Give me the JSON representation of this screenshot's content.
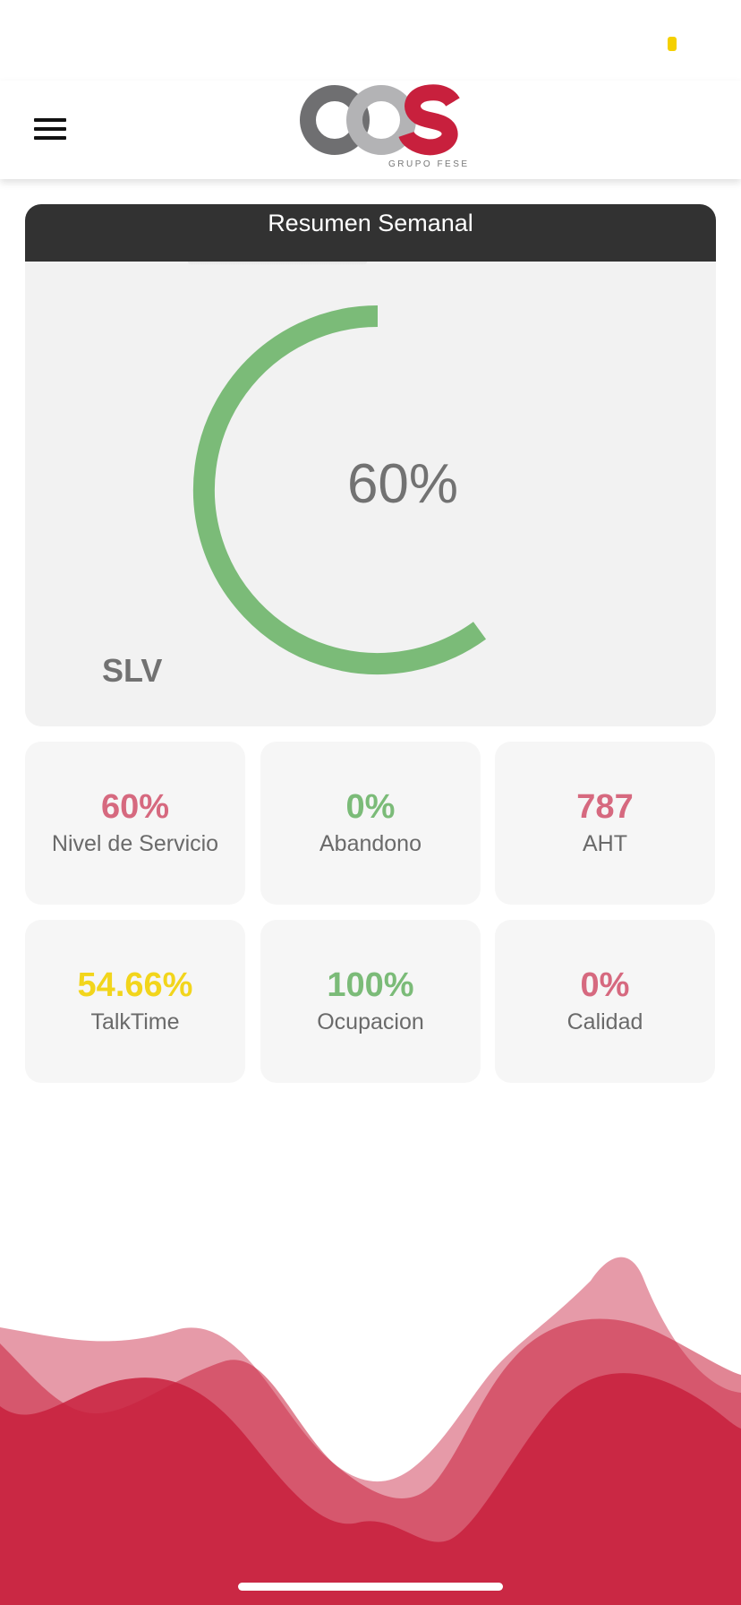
{
  "header": {
    "logo_text": "OCS",
    "logo_subtitle": "GRUPO FESE"
  },
  "colors": {
    "header_dark": "#323232",
    "gauge_green": "#7bbb78",
    "kpi_red": "#d6697f",
    "kpi_green": "#7bbb78",
    "kpi_yellow": "#f2d51c",
    "wave_red": "#c8203d",
    "battery_yellow": "#f5d000"
  },
  "summary": {
    "title": "Resumen Semanal",
    "gauge_value_text": "60%",
    "gauge_fraction": 0.6,
    "gauge_label": "SLV"
  },
  "kpis": [
    {
      "value": "60%",
      "label": "Nivel de Servicio",
      "color": "#d6697f"
    },
    {
      "value": "0%",
      "label": "Abandono",
      "color": "#7bbb78"
    },
    {
      "value": "787",
      "label": "AHT",
      "color": "#d6697f"
    },
    {
      "value": "54.66%",
      "label": "TalkTime",
      "color": "#f2d51c"
    },
    {
      "value": "100%",
      "label": "Ocupacion",
      "color": "#7bbb78"
    },
    {
      "value": "0%",
      "label": "Calidad",
      "color": "#d6697f"
    }
  ]
}
